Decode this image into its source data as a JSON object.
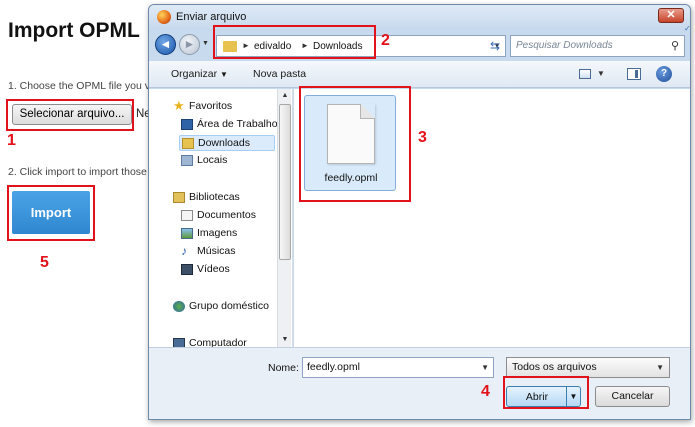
{
  "page": {
    "title": "Import OPML",
    "step1": "1. Choose the OPML file you v",
    "select_button": "Selecionar arquivo...",
    "no_file_text": "Ne",
    "step2": "2. Click import to import those",
    "import_button": "Import"
  },
  "annotations": {
    "colors": {
      "highlight": "#e2121b"
    },
    "numbers": [
      "1",
      "2",
      "3",
      "4",
      "5"
    ]
  },
  "dialog": {
    "title": "Enviar arquivo",
    "close_symbol": "✕",
    "breadcrumb": [
      "edivaldo",
      "Downloads"
    ],
    "search_placeholder": "Pesquisar Downloads",
    "toolbar": {
      "organize": "Organizar",
      "new_folder": "Nova pasta"
    },
    "nav": [
      {
        "label": "Favoritos",
        "icon": "star-icon"
      },
      {
        "label": "Área de Trabalho",
        "icon": "desktop-icon"
      },
      {
        "label": "Downloads",
        "icon": "downloads-folder-icon",
        "selected": true
      },
      {
        "label": "Locais",
        "icon": "places-icon"
      },
      {
        "label": "Bibliotecas",
        "icon": "libraries-icon"
      },
      {
        "label": "Documentos",
        "icon": "documents-icon"
      },
      {
        "label": "Imagens",
        "icon": "images-icon"
      },
      {
        "label": "Músicas",
        "icon": "music-icon"
      },
      {
        "label": "Vídeos",
        "icon": "videos-icon"
      },
      {
        "label": "Grupo doméstico",
        "icon": "homegroup-icon"
      },
      {
        "label": "Computador",
        "icon": "computer-icon"
      }
    ],
    "file": {
      "name": "feedly.opml"
    },
    "name_label": "Nome:",
    "name_value": "feedly.opml",
    "file_type": "Todos os arquivos",
    "open_button": "Abrir",
    "cancel_button": "Cancelar"
  }
}
